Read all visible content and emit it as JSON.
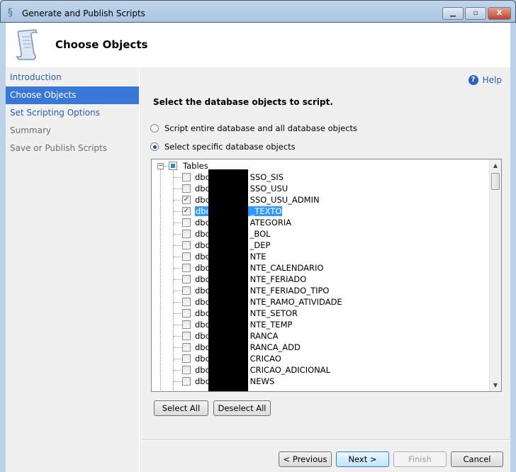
{
  "window": {
    "title": "Generate and Publish Scripts",
    "icon": "scroll-icon"
  },
  "header": {
    "title": "Choose Objects"
  },
  "nav": {
    "items": [
      {
        "label": "Introduction",
        "state": "link"
      },
      {
        "label": "Choose Objects",
        "state": "active"
      },
      {
        "label": "Set Scripting Options",
        "state": "link"
      },
      {
        "label": "Summary",
        "state": "disabled"
      },
      {
        "label": "Save or Publish Scripts",
        "state": "disabled"
      }
    ]
  },
  "main": {
    "help": "Help",
    "instruction": "Select the database objects to script.",
    "radio_entire": "Script entire database and all database objects",
    "radio_specific": "Select specific database objects",
    "selected_radio": "specific",
    "tree": {
      "root": "Tables",
      "items": [
        {
          "prefix": "dbo",
          "suffix": "SSO_SIS",
          "checked": false
        },
        {
          "prefix": "dbo",
          "suffix": "SSO_USU",
          "checked": false
        },
        {
          "prefix": "dbo",
          "suffix": "SSO_USU_ADMIN",
          "checked": true
        },
        {
          "prefix": "dbo",
          "suffix": "_TEXTO",
          "checked": true,
          "selected": true
        },
        {
          "prefix": "dbo",
          "suffix": "ATEGORIA",
          "checked": false
        },
        {
          "prefix": "dbo",
          "suffix": "_BOL",
          "checked": false
        },
        {
          "prefix": "dbo",
          "suffix": "_DEP",
          "checked": false
        },
        {
          "prefix": "dbo",
          "suffix": "NTE",
          "checked": false
        },
        {
          "prefix": "dbo",
          "suffix": "NTE_CALENDARIO",
          "checked": false
        },
        {
          "prefix": "dbo",
          "suffix": "NTE_FERIADO",
          "checked": false
        },
        {
          "prefix": "dbo",
          "suffix": "NTE_FERIADO_TIPO",
          "checked": false
        },
        {
          "prefix": "dbo",
          "suffix": "NTE_RAMO_ATIVIDADE",
          "checked": false
        },
        {
          "prefix": "dbo",
          "suffix": "NTE_SETOR",
          "checked": false
        },
        {
          "prefix": "dbo",
          "suffix": "NTE_TEMP",
          "checked": false
        },
        {
          "prefix": "dbo",
          "suffix": "RANCA",
          "checked": false
        },
        {
          "prefix": "dbo",
          "suffix": "RANCA_ADD",
          "checked": false
        },
        {
          "prefix": "dbo",
          "suffix": "CRICAO",
          "checked": false
        },
        {
          "prefix": "dbo",
          "suffix": "CRICAO_ADICIONAL",
          "checked": false
        },
        {
          "prefix": "dbo",
          "suffix": "NEWS",
          "checked": false
        }
      ]
    },
    "select_all": "Select All",
    "deselect_all": "Deselect All"
  },
  "footer": {
    "previous": "< Previous",
    "next": "Next >",
    "finish": "Finish",
    "cancel": "Cancel"
  },
  "colors": {
    "accent": "#3a78d8",
    "selection": "#3399ff",
    "link": "#2a5db0"
  }
}
